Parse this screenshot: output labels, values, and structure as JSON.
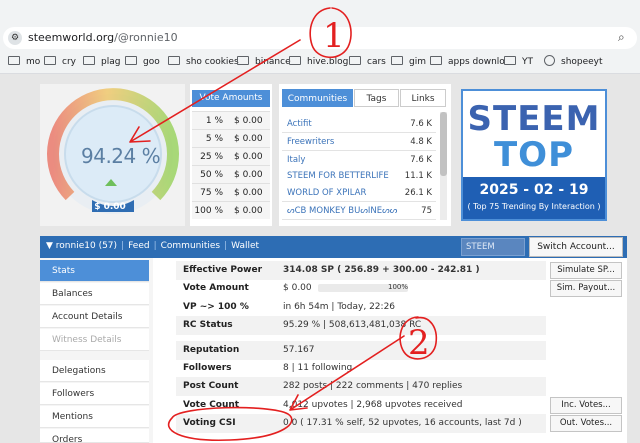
{
  "browser": {
    "url_host": "steemworld.org",
    "url_path": "/@ronnie10",
    "bookmarks": [
      {
        "label": "mo",
        "icon": "folder-icon"
      },
      {
        "label": "cry",
        "icon": "folder-icon"
      },
      {
        "label": "plag",
        "icon": "folder-icon"
      },
      {
        "label": "goo",
        "icon": "folder-icon"
      },
      {
        "label": "sho cookies",
        "icon": "folder-icon"
      },
      {
        "label": "binance",
        "icon": "folder-icon"
      },
      {
        "label": "hive.blog",
        "icon": "folder-icon"
      },
      {
        "label": "cars",
        "icon": "folder-icon"
      },
      {
        "label": "gim",
        "icon": "folder-icon"
      },
      {
        "label": "apps downlo",
        "icon": "folder-icon"
      },
      {
        "label": "YT",
        "icon": "folder-icon"
      },
      {
        "label": "shopeeyt",
        "icon": "globe-icon"
      }
    ]
  },
  "gauge": {
    "percent_label": "94.24 %",
    "percent_value": 94.24,
    "usd_label": "$ 0.00"
  },
  "vote_amounts": {
    "header": "Vote Amounts",
    "rows": [
      {
        "pct": "1 %",
        "amt": "$ 0.00"
      },
      {
        "pct": "5 %",
        "amt": "$ 0.00"
      },
      {
        "pct": "25 %",
        "amt": "$ 0.00"
      },
      {
        "pct": "50 %",
        "amt": "$ 0.00"
      },
      {
        "pct": "75 %",
        "amt": "$ 0.00"
      },
      {
        "pct": "100 %",
        "amt": "$ 0.00"
      }
    ]
  },
  "communities": {
    "tabs": [
      "Communities",
      "Tags",
      "Links"
    ],
    "rows": [
      {
        "name": "Actifit",
        "count": "7.6 K"
      },
      {
        "name": "Freewriters",
        "count": "4.8 K"
      },
      {
        "name": "Italy",
        "count": "7.6 K"
      },
      {
        "name": "STEEM FOR BETTERLIFE",
        "count": "11.1 K"
      },
      {
        "name": "WORLD OF XPILAR",
        "count": "26.1 K"
      },
      {
        "name": "ᔕCB MONKEY BᑌᔕINEᔕᔕ",
        "count": "75"
      }
    ]
  },
  "steem_top": {
    "line1": "STEEM",
    "line2": "TOP 75",
    "date": "2025 - 02 - 19",
    "subtitle": "( Top 75 Trending By Interaction )"
  },
  "navbar": {
    "user": "ronnie10 (57)",
    "links": [
      "Feed",
      "Communities",
      "Wallet"
    ],
    "chain_select": "STEEM",
    "switch_button": "Switch Account..."
  },
  "sidebar": {
    "items": [
      {
        "label": "Stats",
        "state": "active"
      },
      {
        "label": "Balances",
        "state": "normal"
      },
      {
        "label": "Account Details",
        "state": "normal"
      },
      {
        "label": "Witness Details",
        "state": "disabled"
      },
      {
        "label": "Delegations",
        "state": "normal"
      },
      {
        "label": "Followers",
        "state": "normal"
      },
      {
        "label": "Mentions",
        "state": "normal"
      },
      {
        "label": "Orders",
        "state": "normal"
      }
    ]
  },
  "stats": {
    "rows": [
      {
        "label": "Effective Power",
        "value": "314.08 SP ( 256.89 + 300.00 - 242.81 )",
        "bold": true
      },
      {
        "label": "Vote Amount",
        "value": "$ 0.00",
        "bar_pct": "100%",
        "bar_value": 1.0
      },
      {
        "label": "VP ~> 100 %",
        "value": "in 6h 54m  |  Today, 22:26"
      },
      {
        "label": "RC Status",
        "value": "95.29 %  |  508,613,481,038 RC"
      },
      {
        "label": "Reputation",
        "value": "57.167"
      },
      {
        "label": "Followers",
        "value": "8  |  11 following"
      },
      {
        "label": "Post Count",
        "value": "282 posts  |  222 comments  |  470 replies"
      },
      {
        "label": "Vote Count",
        "value": "4,012 upvotes  |  2,968 upvotes received"
      },
      {
        "label": "Voting CSI",
        "value": "0.0 ( 17.31 % self, 52 upvotes, 16 accounts, last 7d )"
      }
    ],
    "buttons": [
      "Simulate SP...",
      "Sim. Payout...",
      "Inc. Votes...",
      "Out. Votes..."
    ]
  },
  "annotations": {
    "marker1": "1",
    "marker2": "2",
    "color": "#e32020"
  }
}
